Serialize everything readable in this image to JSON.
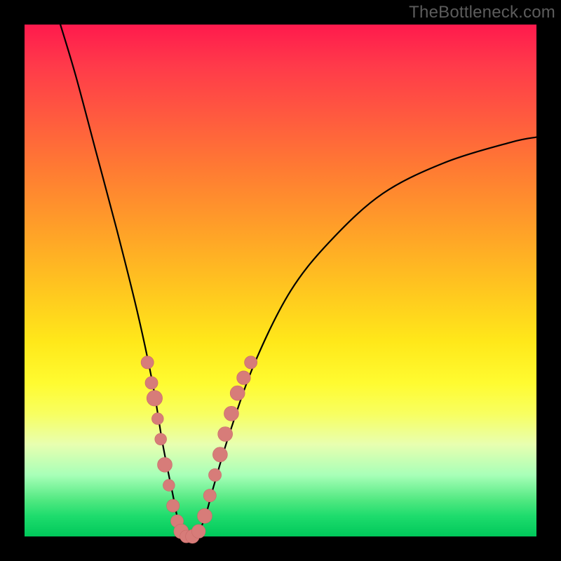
{
  "watermark": "TheBottleneck.com",
  "palette": {
    "curve_stroke": "#000000",
    "marker_fill": "#d77c79",
    "marker_stroke": "#c96a68"
  },
  "chart_data": {
    "type": "line",
    "title": "",
    "xlabel": "",
    "ylabel": "",
    "xlim": [
      0,
      100
    ],
    "ylim": [
      0,
      100
    ],
    "notch_x": 31,
    "series": [
      {
        "name": "bottleneck-curve",
        "points": [
          {
            "x": 7,
            "y": 100
          },
          {
            "x": 10,
            "y": 90
          },
          {
            "x": 14,
            "y": 75
          },
          {
            "x": 18,
            "y": 60
          },
          {
            "x": 22,
            "y": 44
          },
          {
            "x": 25,
            "y": 30
          },
          {
            "x": 27,
            "y": 18
          },
          {
            "x": 29,
            "y": 8
          },
          {
            "x": 30,
            "y": 3
          },
          {
            "x": 31,
            "y": 0
          },
          {
            "x": 33,
            "y": 0
          },
          {
            "x": 35,
            "y": 3
          },
          {
            "x": 37,
            "y": 10
          },
          {
            "x": 40,
            "y": 20
          },
          {
            "x": 45,
            "y": 34
          },
          {
            "x": 52,
            "y": 48
          },
          {
            "x": 60,
            "y": 58
          },
          {
            "x": 70,
            "y": 67
          },
          {
            "x": 82,
            "y": 73
          },
          {
            "x": 95,
            "y": 77
          },
          {
            "x": 100,
            "y": 78
          }
        ]
      }
    ],
    "markers": [
      {
        "x": 24.0,
        "y": 34,
        "r": 1.3
      },
      {
        "x": 24.8,
        "y": 30,
        "r": 1.3
      },
      {
        "x": 25.4,
        "y": 27,
        "r": 1.6
      },
      {
        "x": 26.0,
        "y": 23,
        "r": 1.2
      },
      {
        "x": 26.6,
        "y": 19,
        "r": 1.2
      },
      {
        "x": 27.4,
        "y": 14,
        "r": 1.5
      },
      {
        "x": 28.2,
        "y": 10,
        "r": 1.2
      },
      {
        "x": 29.0,
        "y": 6,
        "r": 1.3
      },
      {
        "x": 29.8,
        "y": 3,
        "r": 1.3
      },
      {
        "x": 30.6,
        "y": 1,
        "r": 1.5
      },
      {
        "x": 31.6,
        "y": 0,
        "r": 1.3
      },
      {
        "x": 32.8,
        "y": 0,
        "r": 1.4
      },
      {
        "x": 34.0,
        "y": 1,
        "r": 1.4
      },
      {
        "x": 35.2,
        "y": 4,
        "r": 1.5
      },
      {
        "x": 36.2,
        "y": 8,
        "r": 1.3
      },
      {
        "x": 37.2,
        "y": 12,
        "r": 1.3
      },
      {
        "x": 38.2,
        "y": 16,
        "r": 1.5
      },
      {
        "x": 39.2,
        "y": 20,
        "r": 1.5
      },
      {
        "x": 40.4,
        "y": 24,
        "r": 1.5
      },
      {
        "x": 41.6,
        "y": 28,
        "r": 1.5
      },
      {
        "x": 42.8,
        "y": 31,
        "r": 1.4
      },
      {
        "x": 44.2,
        "y": 34,
        "r": 1.3
      }
    ]
  }
}
